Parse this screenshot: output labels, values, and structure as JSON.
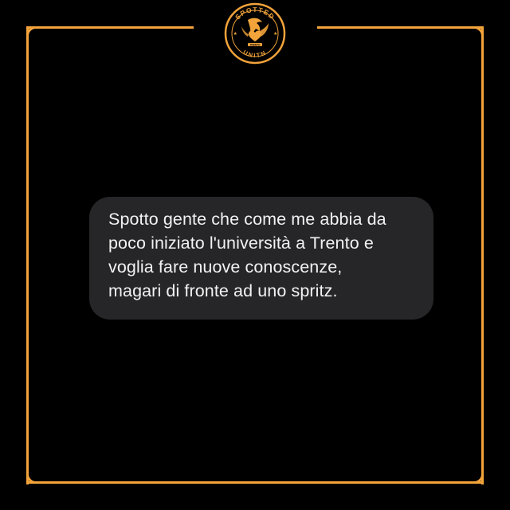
{
  "brand": {
    "logo_top_text": "SPOTTED",
    "logo_bottom_text": "UNITN",
    "logo_mid_text": "TRENTO",
    "accent_color": "#F2A33A",
    "icon": "eagle-heart-emblem"
  },
  "message": {
    "lines": [
      "Spotto gente che come me abbia da",
      "poco iniziato l'università a Trento e",
      "voglia fare nuove conoscenze,",
      "magari di fronte ad uno spritz."
    ]
  }
}
